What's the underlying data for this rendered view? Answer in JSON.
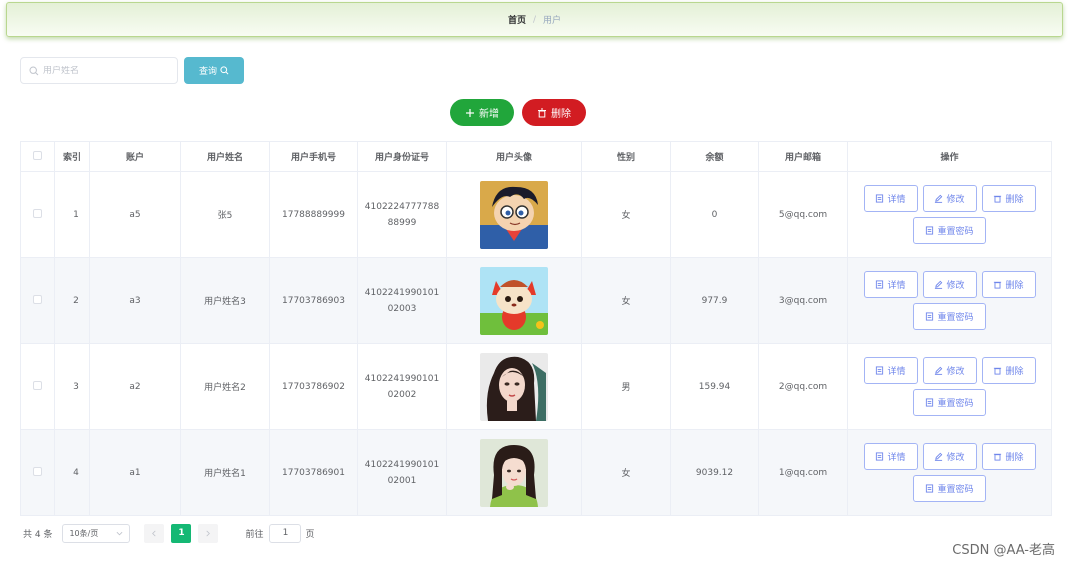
{
  "breadcrumb": {
    "home": "首页",
    "separator": "/",
    "current": "用户"
  },
  "search": {
    "placeholder": "用户姓名",
    "value": "",
    "button_label": "查询"
  },
  "toolbar": {
    "add_label": "新增",
    "delete_label": "删除"
  },
  "table": {
    "headers": [
      "索引",
      "账户",
      "用户姓名",
      "用户手机号",
      "用户身份证号",
      "用户头像",
      "性别",
      "余额",
      "用户邮箱",
      "操作"
    ],
    "rows": [
      {
        "index": "1",
        "account": "a5",
        "name": "张5",
        "phone": "17788889999",
        "id_card": "410222477778888999",
        "avatar": "cartoon-boy-glasses-avatar",
        "gender": "女",
        "balance": "0",
        "email": "5@qq.com"
      },
      {
        "index": "2",
        "account": "a3",
        "name": "用户姓名3",
        "phone": "17703786903",
        "id_card": "410224199010102003",
        "avatar": "cartoon-fox-avatar",
        "gender": "女",
        "balance": "977.9",
        "email": "3@qq.com"
      },
      {
        "index": "3",
        "account": "a2",
        "name": "用户姓名2",
        "phone": "17703786902",
        "id_card": "410224199010102002",
        "avatar": "illustrated-woman-avatar",
        "gender": "男",
        "balance": "159.94",
        "email": "2@qq.com"
      },
      {
        "index": "4",
        "account": "a1",
        "name": "用户姓名1",
        "phone": "17703786901",
        "id_card": "410224199010102001",
        "avatar": "girl-photo-avatar",
        "gender": "女",
        "balance": "9039.12",
        "email": "1@qq.com"
      }
    ],
    "actions": {
      "detail": "详情",
      "edit": "修改",
      "delete": "删除",
      "reset_password": "重置密码"
    }
  },
  "pagination": {
    "total": "共 4 条",
    "page_size": "10条/页",
    "current_page": "1",
    "goto_label": "前往",
    "goto_value": "1",
    "page_suffix": "页"
  },
  "watermark": "CSDN @AA-老高",
  "colors": {
    "primary_green": "#21a63b",
    "danger_red": "#d21c22",
    "query_teal": "#56b9cf",
    "op_border": "#a3b4f5",
    "page_active": "#14b874"
  }
}
